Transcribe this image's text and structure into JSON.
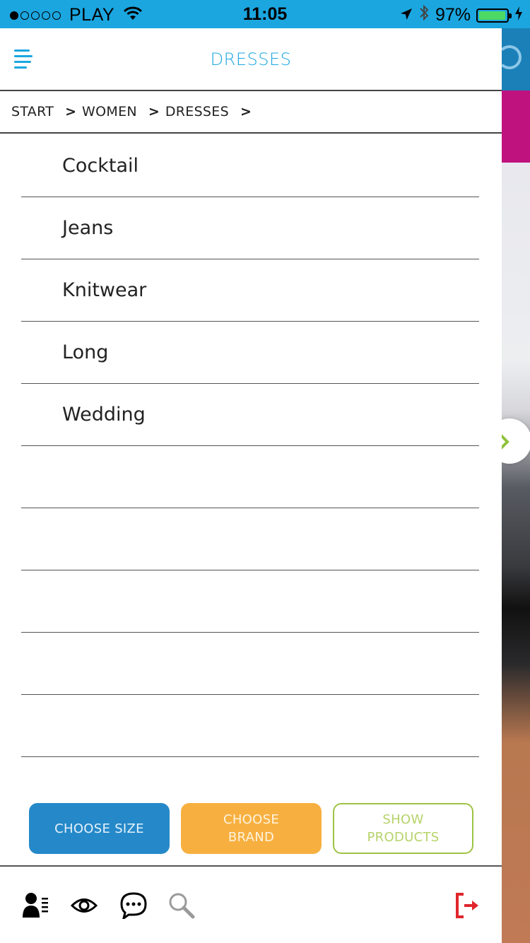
{
  "status_bar": {
    "carrier": "PLAY",
    "time": "11:05",
    "battery": "97%",
    "battery_level": 0.97,
    "signal_bars": 1
  },
  "header": {
    "title": "DRESSES",
    "accent_color": "#1ba6e0"
  },
  "breadcrumb": {
    "items": [
      "START",
      "WOMEN",
      "DRESSES"
    ],
    "separator": ">"
  },
  "categories": [
    "Cocktail",
    "Jeans",
    "Knitwear",
    "Long",
    "Wedding",
    "",
    "",
    "",
    "",
    ""
  ],
  "actions": {
    "choose_size": "CHOOSE SIZE",
    "choose_brand": "CHOOSE BRAND",
    "show_products": "SHOW PRODUCTS"
  },
  "footer": {
    "icons": [
      "profile-list-icon",
      "eye-icon",
      "chat-icon",
      "search-icon",
      "logout-icon"
    ]
  },
  "colors": {
    "size_button": "#2589c9",
    "brand_button": "#f7b040",
    "show_button_border": "#9ec345",
    "logout": "#e0262c"
  }
}
